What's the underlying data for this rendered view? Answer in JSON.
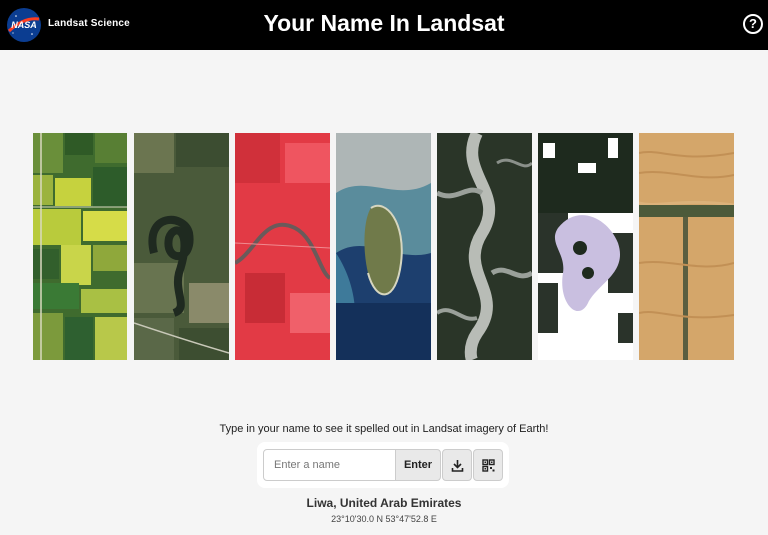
{
  "header": {
    "brand_label": "Landsat Science",
    "logo_text": "NASA",
    "title": "Your Name In Landsat",
    "help_icon": "question-circle-icon",
    "help_symbol": "?"
  },
  "strips": [
    {
      "name": "farm-fields"
    },
    {
      "name": "oxbow-river"
    },
    {
      "name": "red-false-color-river"
    },
    {
      "name": "island-coast"
    },
    {
      "name": "braided-river"
    },
    {
      "name": "snow-lake"
    },
    {
      "name": "desert-dunes"
    }
  ],
  "prompt": {
    "instruction": "Type in your name to see it spelled out in Landsat imagery of Earth!",
    "input_placeholder": "Enter a name",
    "input_value": "",
    "enter_label": "Enter",
    "download_icon": "download-icon",
    "qr_icon": "qr-code-icon"
  },
  "location": {
    "name": "Liwa, United Arab Emirates",
    "coords": "23°10'30.0 N 53°47'52.8 E"
  },
  "colors": {
    "header_bg": "#000000",
    "page_bg": "#f5f5f5",
    "button_bg": "#e9e9e9"
  }
}
